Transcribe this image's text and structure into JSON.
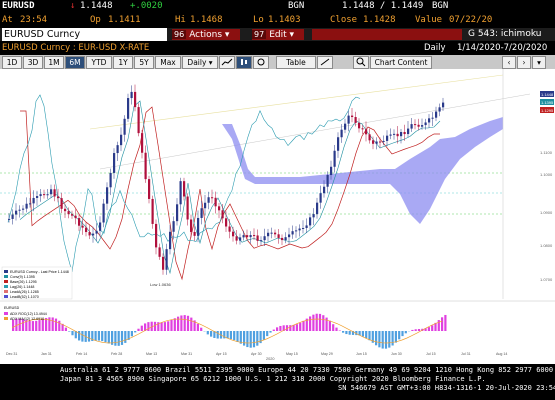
{
  "header": {
    "ticker": "EURUSD",
    "arrow": "↓",
    "last": "1.1448",
    "change": "+.0020",
    "source": "BGN",
    "bid_ask": "1.1448 / 1.1449",
    "source2": "BGN",
    "at_label": "At",
    "time": "23:54",
    "op_label": "Op",
    "open": "1.1411",
    "hi_label": "Hi",
    "high": "1.1468",
    "lo_label": "Lo",
    "low": "1.1403",
    "close_label": "Close",
    "close": "1.1428",
    "value_label": "Value",
    "value_date": "07/22/20"
  },
  "titlebar": {
    "security": "EURUSD Curncy",
    "actions_num": "96",
    "actions_label": "Actions ▾",
    "edit_num": "97",
    "edit_label": "Edit ▾",
    "page_info": "G 543: ichimoku"
  },
  "subbar": {
    "name": "EURUSD Curncy : EUR-USD X-RATE",
    "period": "Daily",
    "range": "1/14/2020-7/20/2020"
  },
  "toolbar": {
    "ranges": [
      "1D",
      "3D",
      "1M",
      "6M",
      "YTD",
      "1Y",
      "5Y",
      "Max"
    ],
    "selected": "6M",
    "freq": "Daily ▾",
    "table": "Table",
    "chart_content": "Chart Content"
  },
  "legend": {
    "title": "EURUSD Curncy - Last Price",
    "items": [
      {
        "label": "EURUSD Curncy - Last Price 1.1448",
        "color": "#2a3a8a"
      },
      {
        "label": "Conv(9) 1.1395",
        "color": "#1e8fa0"
      },
      {
        "label": "Base(26) 1.1295",
        "color": "#c02020"
      },
      {
        "label": "Lag(26) 1.1448",
        "color": "#2a9bb0"
      },
      {
        "label": "LeadA(26) 1.1285",
        "color": "#e07070"
      },
      {
        "label": "LeadB(52) 1.1070",
        "color": "#5050d0"
      }
    ]
  },
  "macd_legend": {
    "title": "EURUSD",
    "items": [
      {
        "label": "ADX ROC(12) 13.4944",
        "color": "#e040e0"
      },
      {
        "label": "ADX MA(12) 12.6910",
        "color": "#f0a030"
      }
    ]
  },
  "low_marker": "Low 1.0636",
  "price_labels": [
    "1.1448",
    "1.1395",
    "1.1295",
    "1.1100",
    "1.1000",
    "1.0900",
    "1.0800",
    "1.0700"
  ],
  "x_labels": [
    "Dec 31",
    "Jan 31",
    "Feb 14",
    "Feb 28",
    "Mar 13",
    "Mar 31",
    "Apr 15",
    "Apr 30",
    "May 15",
    "May 29",
    "Jun 15",
    "Jun 30",
    "Jul 15",
    "Jul 31",
    "Aug 14"
  ],
  "x_year": "2020",
  "footer": {
    "line1": "Australia 61 2 9777 8600 Brazil 5511 2395 9000 Europe 44 20 7330 7500 Germany 49 69 9204 1210 Hong Kong 852 2977 6000",
    "line2": "Japan 81 3 4565 8900       Singapore 65 6212 1000       U.S. 1 212 318 2000             Copyright 2020 Bloomberg Finance L.P.",
    "line3": "SN 546679 AST  GMT+3:00 H834-1316-1 20-Jul-2020 23:54:36"
  },
  "colors": {
    "up": "#2a3a8a",
    "down": "#b0103c",
    "cloud": "#8c8cf0",
    "conv": "#1e8fa0",
    "base": "#c02020",
    "lag": "#2a9bb0"
  }
}
